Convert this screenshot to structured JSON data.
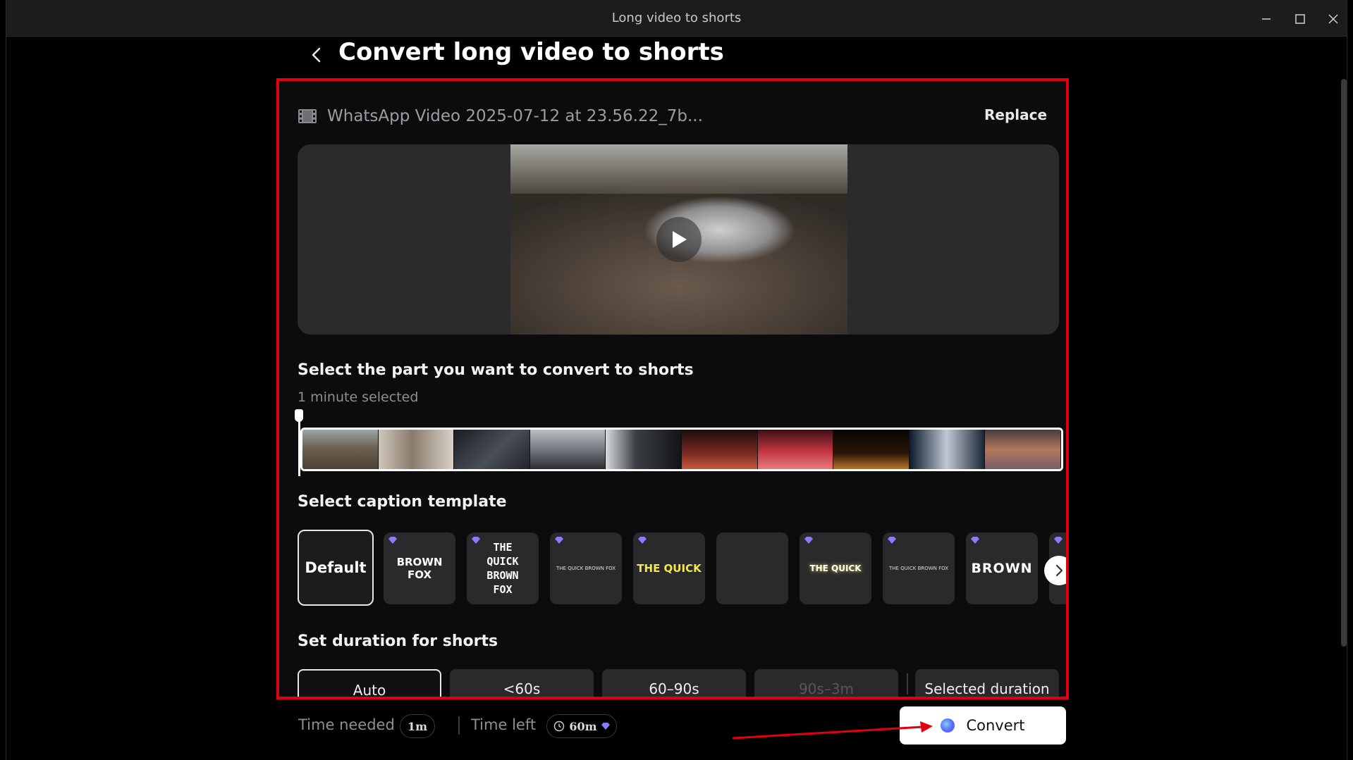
{
  "window": {
    "title": "Long video to shorts",
    "minimize_icon": "minimize-icon",
    "maximize_icon": "maximize-icon",
    "close_icon": "close-icon"
  },
  "header": {
    "back_icon": "chevron-left-icon",
    "title": "Convert long video to shorts"
  },
  "file": {
    "icon": "film-icon",
    "name": "WhatsApp Video 2025-07-12 at 23.56.22_7b...",
    "replace_label": "Replace"
  },
  "preview": {
    "play_icon": "play-icon"
  },
  "selection": {
    "title": "Select the part you want to convert to shorts",
    "subtitle": "1 minute selected"
  },
  "captions": {
    "title": "Select caption template",
    "templates": [
      {
        "label": "Default",
        "premium": false
      },
      {
        "label": "BROWN FOX",
        "premium": true
      },
      {
        "label": "THE QUICK BROWN FOX",
        "premium": true
      },
      {
        "label": "THE QUICK BROWN FOX",
        "premium": true
      },
      {
        "label": "THE QUICK",
        "premium": true
      },
      {
        "label": "",
        "premium": false
      },
      {
        "label": "THE QUICK",
        "premium": true
      },
      {
        "label": "THE QUICK BROWN FOX",
        "premium": true
      },
      {
        "label": "BROWN",
        "premium": true
      }
    ],
    "next_icon": "chevron-right-icon",
    "premium_icon": "gem-icon"
  },
  "duration": {
    "title": "Set duration for shorts",
    "options": [
      "Auto",
      "<60s",
      "60–90s",
      "90s–3m",
      "Selected duration"
    ],
    "selected": "Auto"
  },
  "footer": {
    "time_needed_label": "Time needed",
    "time_needed_value": "1m",
    "time_left_label": "Time left",
    "time_left_value": "60m",
    "clock_icon": "clock-icon",
    "convert_label": "Convert"
  },
  "colors": {
    "highlight": "#e00010",
    "accent_purple": "#8a7cff",
    "background": "#000000"
  }
}
